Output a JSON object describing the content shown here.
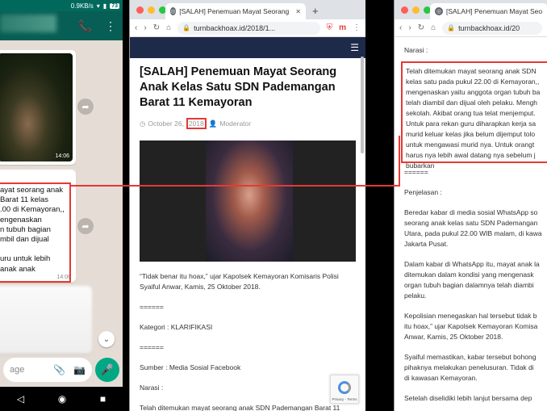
{
  "phone": {
    "status": {
      "speed": "0.9KB/s",
      "battery": "73"
    },
    "image_time": "14:06",
    "message_text": "ayat seorang anak\nBarat 11 kelas\n.00 di Kemayoran,,\nengenaskan\nn tubuh bagian\nmbil dan dijual\n\nuru untuk lebih\nanak anak",
    "message_time": "14:06",
    "composer_placeholder": "age"
  },
  "mid_browser": {
    "tab_title": "[SALAH] Penemuan Mayat Seorang",
    "url": "turnbackhoax.id/2018/1...",
    "article_title": "[SALAH] Penemuan Mayat Seorang Anak Kelas Satu SDN Pademangan Barat 11 Kemayoran",
    "date_prefix": "October 26,",
    "date_year": "2018",
    "author": "Moderator",
    "quote": "“Tidak benar itu hoax,” ujar Kapolsek Kemayoran Komisaris Polisi Syaiful Anwar, Kamis, 25 Oktober 2018.",
    "separator1": "======",
    "category": "Kategori : KLARIFIKASI",
    "separator2": "======",
    "source": "Sumber : Media Sosial Facebook",
    "narasi_label": "Narasi :",
    "narasi_start": "Telah ditemukan mayat seorang anak SDN Pademangan Barat 11",
    "recaptcha_label": "Privacy - Terms"
  },
  "right_browser": {
    "tab_title": "[SALAH] Penemuan Mayat Seo",
    "url": "turnbackhoax.id/20",
    "narasi_label": "Narasi :",
    "narasi_text": "Telah ditemukan mayat seorang anak SDN\nkelas satu pada pukul 22.00 di Kemayoran,,\nmengenaskan yaitu anggota organ tubuh ba\ntelah diambil dan dijual oleh pelaku. Mengh\nsekolah. Akibat orang tua telat menjemput.\nUntuk para rekan guru diharapkan kerja sa\nmurid keluar kelas jika belum dijemput tolo\nuntuk mengawasi murid nya. Untuk orangt\nharus nya lebih awal datang nya sebelum j\nbubarkan",
    "separator": "======",
    "penjelasan_label": "Penjelasan :",
    "para1": "Beredar kabar di media sosial WhatsApp so\nseorang anak kelas satu SDN Pademangan\nUtara, pada pukul 22.00 WIB malam, di kawa\nJakarta Pusat.",
    "para2": "Dalam kabar di WhatsApp itu, mayat anak la\nditemukan dalam kondisi yang mengenask\norgan tubuh bagian dalamnya telah diambi\npelaku.",
    "para3": "Kepolisian menegaskan hal tersebut tidak b\nitu hoax,” ujar Kapolsek Kemayoran Komisa\nAnwar, Kamis, 25 Oktober 2018.",
    "para4": "Syaiful memastikan, kabar tersebut bohong\npihaknya melakukan penelusuran. Tidak di\ndi kawasan Kemayoran.",
    "para5": "Setelah diselidiki lebih lanjut bersama dep"
  },
  "colors": {
    "highlight": "#e53935",
    "whatsapp_green": "#075e54",
    "site_nav": "#1e2a4a"
  },
  "icons": [
    "add-call-icon",
    "more-icon",
    "share-icon",
    "attach-icon",
    "camera-icon",
    "mic-icon",
    "lock-icon",
    "back-icon",
    "forward-icon",
    "reload-icon",
    "home-icon",
    "menu-icon"
  ]
}
